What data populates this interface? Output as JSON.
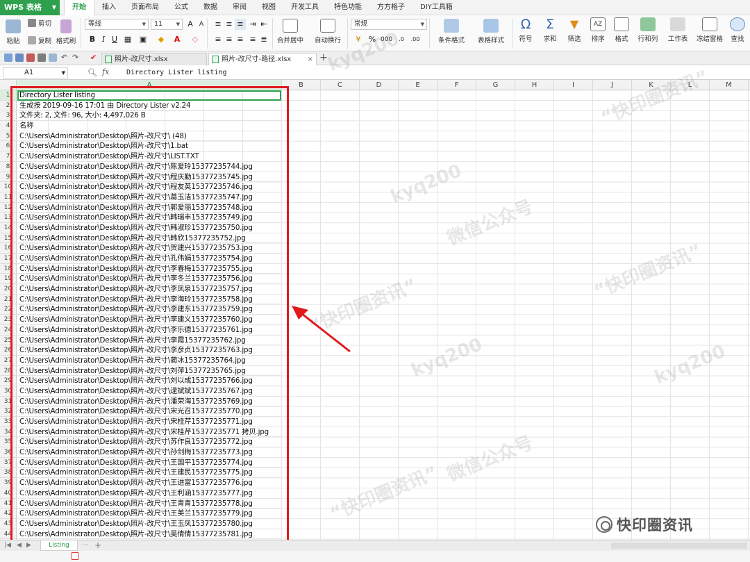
{
  "app": {
    "name": "WPS 表格"
  },
  "menu": [
    "开始",
    "插入",
    "页面布局",
    "公式",
    "数据",
    "审阅",
    "视图",
    "开发工具",
    "特色功能",
    "方方格子",
    "DIY工具箱"
  ],
  "ribbon": {
    "paste": "粘贴",
    "cut": "剪切",
    "copy": "复制",
    "format_painter": "格式刷",
    "font_name": "等线",
    "font_size": "11",
    "bold": "B",
    "italic": "I",
    "underline": "U",
    "merge_center": "合并居中",
    "wrap": "自动换行",
    "number_format": "常规",
    "percent": "%",
    "cond_format": "条件格式",
    "table_style": "表格样式",
    "symbol": "符号",
    "sum": "求和",
    "filter": "筛选",
    "sort": "排序",
    "format": "格式",
    "row_col": "行和列",
    "worksheet": "工作表",
    "freeze": "冻结窗格",
    "find": "查找"
  },
  "tabs": [
    {
      "label": "照片-改尺寸.xlsx",
      "active": false
    },
    {
      "label": "照片-改尺寸-路径.xlsx",
      "active": true
    }
  ],
  "formula_bar": {
    "cell": "A1",
    "fx": "fx",
    "content": "Directory Lister listing"
  },
  "columns": [
    "A",
    "B",
    "C",
    "D",
    "E",
    "F",
    "G",
    "H",
    "I",
    "J",
    "K",
    "L",
    "M"
  ],
  "rows": [
    "Directory Lister listing",
    "生成按 2019-09-16 17:01 由 Directory Lister v2.24",
    "文件夹: 2, 文件: 96, 大小: 4,497,026 B",
    "名称",
    "C:\\Users\\Administrator\\Desktop\\照片-改尺寸\\ (48)",
    "C:\\Users\\Administrator\\Desktop\\照片-改尺寸\\1.bat",
    "C:\\Users\\Administrator\\Desktop\\照片-改尺寸\\LIST.TXT",
    "C:\\Users\\Administrator\\Desktop\\照片-改尺寸\\陈爱玲15377235744.jpg",
    "C:\\Users\\Administrator\\Desktop\\照片-改尺寸\\程庆勤15377235745.jpg",
    "C:\\Users\\Administrator\\Desktop\\照片-改尺寸\\程友英15377235746.jpg",
    "C:\\Users\\Administrator\\Desktop\\照片-改尺寸\\葛玉洁15377235747.jpg",
    "C:\\Users\\Administrator\\Desktop\\照片-改尺寸\\郭爱丽15377235748.jpg",
    "C:\\Users\\Administrator\\Desktop\\照片-改尺寸\\韩瑞丰15377235749.jpg",
    "C:\\Users\\Administrator\\Desktop\\照片-改尺寸\\韩淑珍15377235750.jpg",
    "C:\\Users\\Administrator\\Desktop\\照片-改尺寸\\韩欣15377235752.jpg",
    "C:\\Users\\Administrator\\Desktop\\照片-改尺寸\\贺建兴15377235753.jpg",
    "C:\\Users\\Administrator\\Desktop\\照片-改尺寸\\孔伟娟15377235754.jpg",
    "C:\\Users\\Administrator\\Desktop\\照片-改尺寸\\李春梅15377235755.jpg",
    "C:\\Users\\Administrator\\Desktop\\照片-改尺寸\\李冬兰15377235756.jpg",
    "C:\\Users\\Administrator\\Desktop\\照片-改尺寸\\李凤泉15377235757.jpg",
    "C:\\Users\\Administrator\\Desktop\\照片-改尺寸\\李海玲15377235758.jpg",
    "C:\\Users\\Administrator\\Desktop\\照片-改尺寸\\李建东15377235759.jpg",
    "C:\\Users\\Administrator\\Desktop\\照片-改尺寸\\李建义15377235760.jpg",
    "C:\\Users\\Administrator\\Desktop\\照片-改尺寸\\李乐德15377235761.jpg",
    "C:\\Users\\Administrator\\Desktop\\照片-改尺寸\\李霞15377235762.jpg",
    "C:\\Users\\Administrator\\Desktop\\照片-改尺寸\\李彦贞15377235763.jpg",
    "C:\\Users\\Administrator\\Desktop\\照片-改尺寸\\蔺冰15377235764.jpg",
    "C:\\Users\\Administrator\\Desktop\\照片-改尺寸\\刘萍15377235765.jpg",
    "C:\\Users\\Administrator\\Desktop\\照片-改尺寸\\刘以成15377235766.jpg",
    "C:\\Users\\Administrator\\Desktop\\照片-改尺寸\\逯斌斌15377235767.jpg",
    "C:\\Users\\Administrator\\Desktop\\照片-改尺寸\\潘荣海15377235769.jpg",
    "C:\\Users\\Administrator\\Desktop\\照片-改尺寸\\宋光召15377235770.jpg",
    "C:\\Users\\Administrator\\Desktop\\照片-改尺寸\\宋桂芹15377235771.jpg",
    "C:\\Users\\Administrator\\Desktop\\照片-改尺寸\\宋桂芹15377235771 拷贝.jpg",
    "C:\\Users\\Administrator\\Desktop\\照片-改尺寸\\苏作良15377235772.jpg",
    "C:\\Users\\Administrator\\Desktop\\照片-改尺寸\\孙剑梅15377235773.jpg",
    "C:\\Users\\Administrator\\Desktop\\照片-改尺寸\\王国平15377235774.jpg",
    "C:\\Users\\Administrator\\Desktop\\照片-改尺寸\\王建民15377235775.jpg",
    "C:\\Users\\Administrator\\Desktop\\照片-改尺寸\\王进富15377235776.jpg",
    "C:\\Users\\Administrator\\Desktop\\照片-改尺寸\\王利涵15377235777.jpg",
    "C:\\Users\\Administrator\\Desktop\\照片-改尺寸\\王青青15377235778.jpg",
    "C:\\Users\\Administrator\\Desktop\\照片-改尺寸\\王美兰15377235779.jpg",
    "C:\\Users\\Administrator\\Desktop\\照片-改尺寸\\王玉凤15377235780.jpg",
    "C:\\Users\\Administrator\\Desktop\\照片-改尺寸\\吴倩倩15377235781.jpg"
  ],
  "sheet_tab": "Listing",
  "watermark": [
    "kyq200",
    "微信公众号",
    "“快印圈资讯”"
  ],
  "logo_text": "快印圈资讯",
  "colors": {
    "accent": "#2fa04e",
    "highlight": "#e0191c"
  }
}
